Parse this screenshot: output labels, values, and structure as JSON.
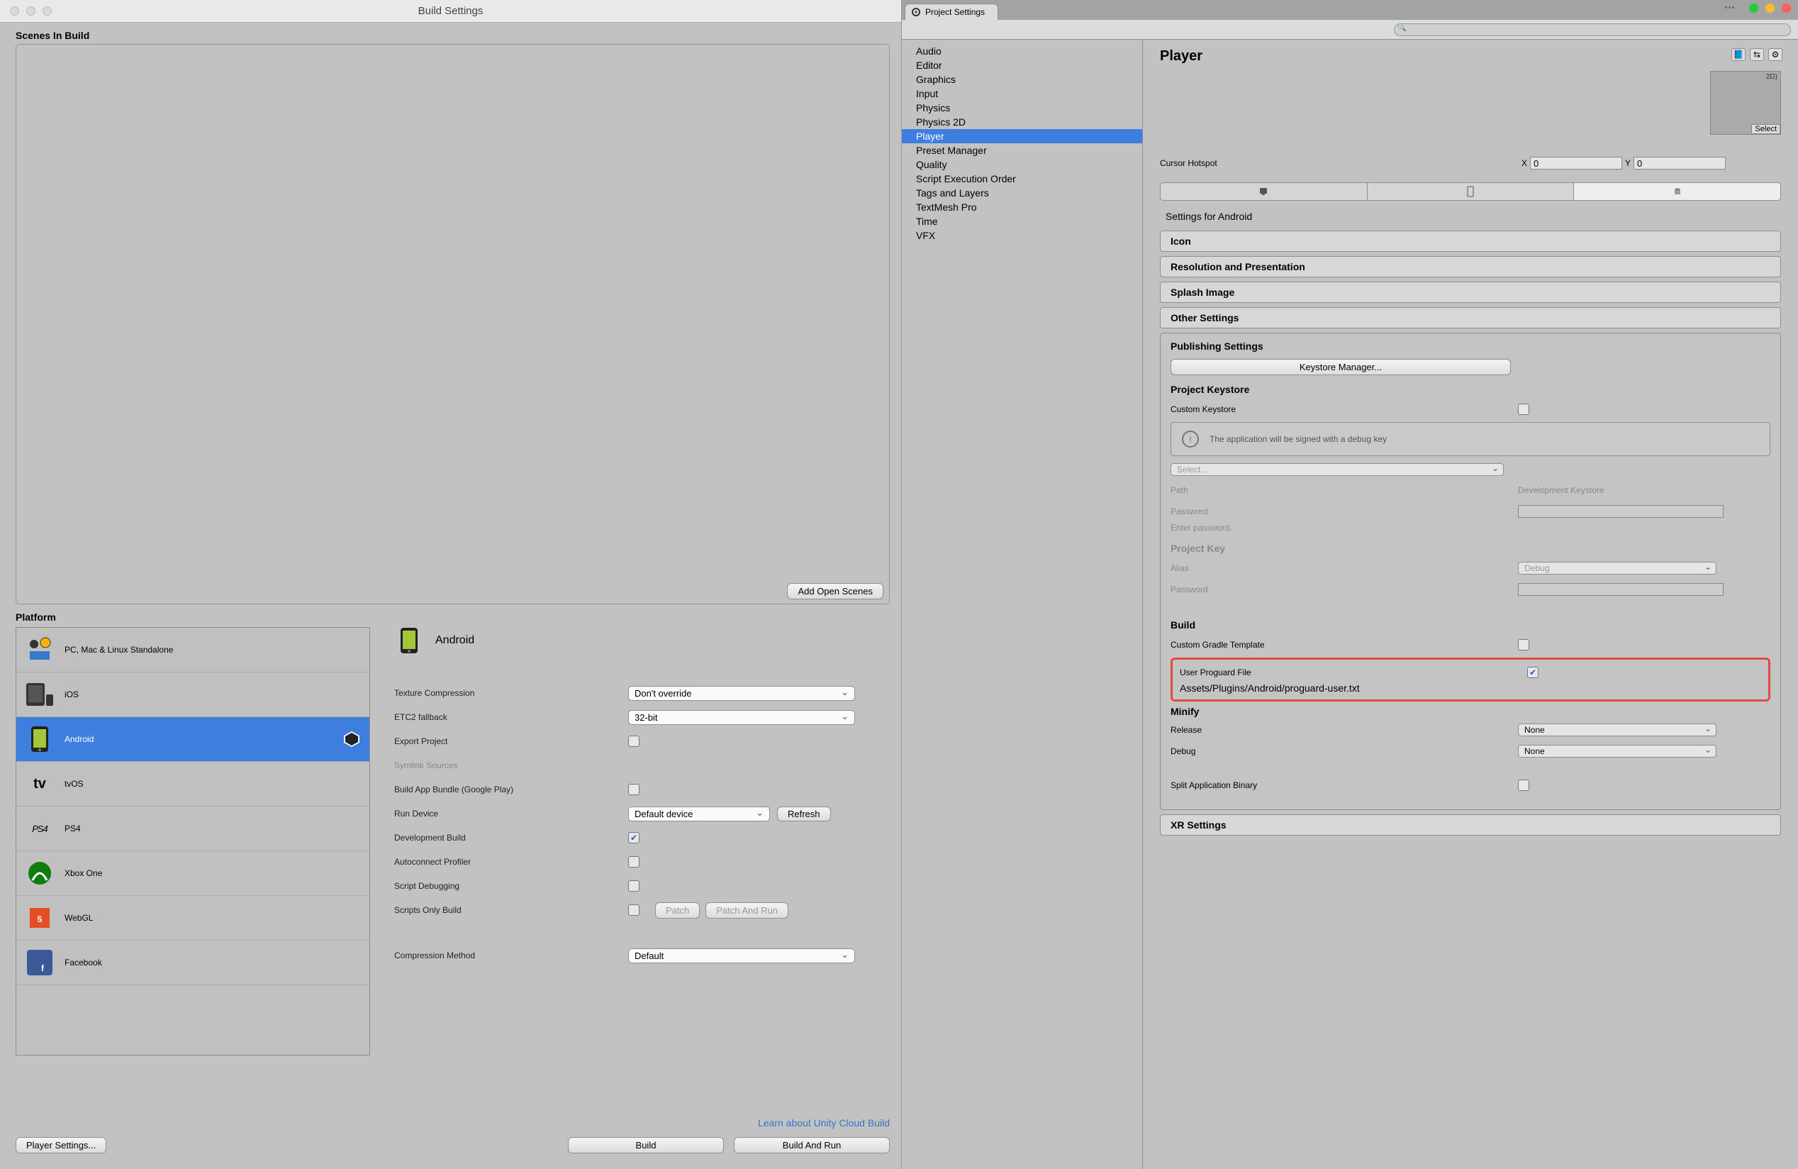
{
  "buildWindow": {
    "title": "Build Settings",
    "scenesHeader": "Scenes In Build",
    "addOpenScenes": "Add Open Scenes",
    "platformHeader": "Platform",
    "platforms": [
      {
        "label": "PC, Mac & Linux Standalone"
      },
      {
        "label": "iOS"
      },
      {
        "label": "Android"
      },
      {
        "label": "tvOS"
      },
      {
        "label": "PS4"
      },
      {
        "label": "Xbox One"
      },
      {
        "label": "WebGL"
      },
      {
        "label": "Facebook"
      }
    ],
    "selectedPlatform": "Android",
    "options": {
      "textureCompression": {
        "label": "Texture Compression",
        "value": "Don't override"
      },
      "etc2": {
        "label": "ETC2 fallback",
        "value": "32-bit"
      },
      "exportProject": {
        "label": "Export Project"
      },
      "symlink": {
        "label": "Symlink Sources"
      },
      "aab": {
        "label": "Build App Bundle (Google Play)"
      },
      "runDevice": {
        "label": "Run Device",
        "value": "Default device",
        "refresh": "Refresh"
      },
      "devBuild": {
        "label": "Development Build",
        "checked": true
      },
      "autoProfiler": {
        "label": "Autoconnect Profiler"
      },
      "scriptDebug": {
        "label": "Script Debugging"
      },
      "scriptsOnly": {
        "label": "Scripts Only Build",
        "patch": "Patch",
        "patchRun": "Patch And Run"
      },
      "compression": {
        "label": "Compression Method",
        "value": "Default"
      }
    },
    "cloudLink": "Learn about Unity Cloud Build",
    "playerSettingsBtn": "Player Settings...",
    "buildBtn": "Build",
    "buildRunBtn": "Build And Run"
  },
  "settingsWindow": {
    "tab": "Project Settings",
    "categories": [
      "Audio",
      "Editor",
      "Graphics",
      "Input",
      "Physics",
      "Physics 2D",
      "Player",
      "Preset Manager",
      "Quality",
      "Script Execution Order",
      "Tags and Layers",
      "TextMesh Pro",
      "Time",
      "VFX"
    ],
    "selectedCategory": "Player",
    "title": "Player",
    "thumb": {
      "label": "2D)",
      "select": "Select"
    },
    "cursorHotspot": {
      "label": "Cursor Hotspot",
      "x": "X",
      "xval": "0",
      "y": "Y",
      "yval": "0"
    },
    "settingsForAndroid": "Settings for Android",
    "accordions": {
      "icon": "Icon",
      "resPres": "Resolution and Presentation",
      "splash": "Splash Image",
      "other": "Other Settings",
      "xr": "XR Settings"
    },
    "publishing": {
      "header": "Publishing Settings",
      "keystoreManager": "Keystore Manager...",
      "projectKeystore": "Project Keystore",
      "customKeystore": "Custom Keystore",
      "debugInfo": "The application will be signed with a debug key",
      "selectDD": "Select...",
      "path": {
        "label": "Path",
        "value": "Development Keystore"
      },
      "password": {
        "label": "Password",
        "hint": "Enter password."
      },
      "projectKey": "Project Key",
      "alias": {
        "label": "Alias",
        "value": "Debug"
      },
      "password2": "Password",
      "build": "Build",
      "customGradle": "Custom Gradle Template",
      "proguard": {
        "label": "User Proguard File",
        "path": "Assets/Plugins/Android/proguard-user.txt",
        "checked": true
      },
      "minify": "Minify",
      "release": {
        "label": "Release",
        "value": "None"
      },
      "debug": {
        "label": "Debug",
        "value": "None"
      },
      "splitBinary": "Split Application Binary"
    }
  }
}
